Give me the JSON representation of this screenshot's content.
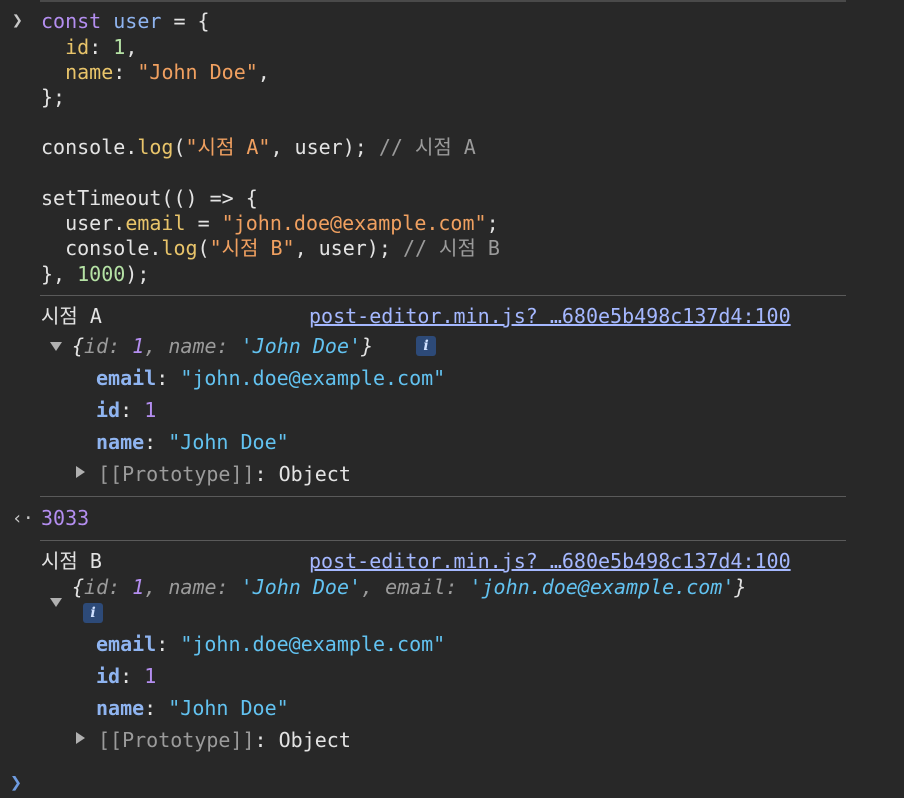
{
  "code": {
    "l1_kw": "const",
    "l1_var": "user",
    "l1_rest": " = {",
    "l2_prop": "id",
    "l2_num": "1",
    "l3_prop": "name",
    "l3_str": "\"John Doe\"",
    "l4": "};",
    "l6_a": "console.",
    "l6_fn": "log",
    "l6_str": "\"시점 A\"",
    "l6_mid": ", user); ",
    "l6_cmt": "// 시점 A",
    "l8": "setTimeout(() => {",
    "l9_a": "user.",
    "l9_prop": "email",
    "l9_eq": " = ",
    "l9_str": "\"john.doe@example.com\"",
    "l10_a": "console.",
    "l10_fn": "log",
    "l10_str": "\"시점 B\"",
    "l10_mid": ", user); ",
    "l10_cmt": "// 시점 B",
    "l11_a": "}, ",
    "l11_num": "1000",
    "l11_b": ");"
  },
  "logA": {
    "label": "시점 A",
    "source": "post-editor.min.js? …680e5b498c137d4:100",
    "summary": {
      "open": "{",
      "k1": "id",
      "v1": "1",
      "k2": "name",
      "v2": "'John Doe'",
      "close": "}"
    },
    "props": [
      {
        "key": "email",
        "value": "\"john.doe@example.com\"",
        "type": "string"
      },
      {
        "key": "id",
        "value": "1",
        "type": "number"
      },
      {
        "key": "name",
        "value": "\"John Doe\"",
        "type": "string"
      }
    ],
    "prototype_label": "[[Prototype]]",
    "prototype_value": "Object"
  },
  "return_value": "3033",
  "logB": {
    "label": "시점 B",
    "source": "post-editor.min.js? …680e5b498c137d4:100",
    "summary": {
      "open": "{",
      "k1": "id",
      "v1": "1",
      "k2": "name",
      "v2": "'John Doe'",
      "k3": "email",
      "v3": "'john.doe@example.com'",
      "close": "}"
    },
    "props": [
      {
        "key": "email",
        "value": "\"john.doe@example.com\"",
        "type": "string"
      },
      {
        "key": "id",
        "value": "1",
        "type": "number"
      },
      {
        "key": "name",
        "value": "\"John Doe\"",
        "type": "string"
      }
    ],
    "prototype_label": "[[Prototype]]",
    "prototype_value": "Object"
  },
  "icons": {
    "input_prompt": "chevron-right-icon",
    "return_arrow": "return-arrow-icon",
    "info_badge": "info-icon"
  },
  "info_badge_text": "i",
  "colors": {
    "background": "#282828",
    "link": "#a5b8ff",
    "keyword": "#b48ef0",
    "string": "#f0a060"
  }
}
